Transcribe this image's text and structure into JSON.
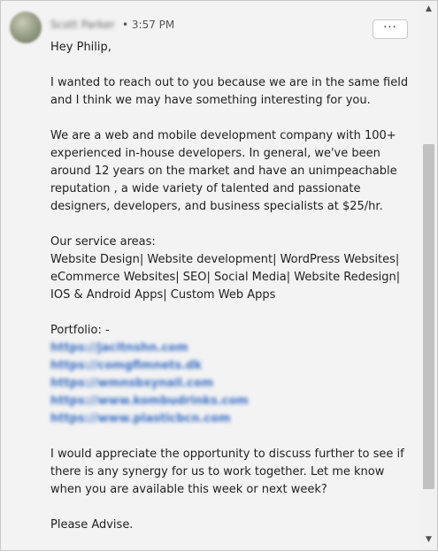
{
  "header": {
    "sender_name": "Scott Parker",
    "timestamp": "• 3:57 PM",
    "more_label": "···"
  },
  "message": {
    "greeting": "Hey Philip,",
    "para1": "I wanted to reach out to you because we are in the same field and I think we may have something interesting for you.",
    "para2": "We are a web and mobile development company with 100+ experienced in-house developers. In general, we've been around 12 years on the market and have an unimpeachable reputation , a wide variety of talented and passionate designers, developers, and business specialists at $25/hr.",
    "service_heading": "Our service areas:",
    "service_list": "Website Design| Website development| WordPress Websites| eCommerce Websites| SEO| Social Media| Website Redesign| IOS & Android Apps| Custom Web Apps",
    "portfolio_heading": "Portfolio: -",
    "portfolio_links": [
      "https://jacitnshn.com",
      "https://comgfimnets.dk",
      "https://wmnsbxynail.com",
      "https://www.kombudrinks.com",
      "https://www.plasticbcn.com"
    ],
    "para3": "I would appreciate the opportunity to discuss further to see if there is any synergy for us to work together. Let me know when you are available this week or next week?",
    "closing": "Please Advise."
  },
  "scrollbar": {
    "up_icon": "▲",
    "down_icon": "▼"
  }
}
